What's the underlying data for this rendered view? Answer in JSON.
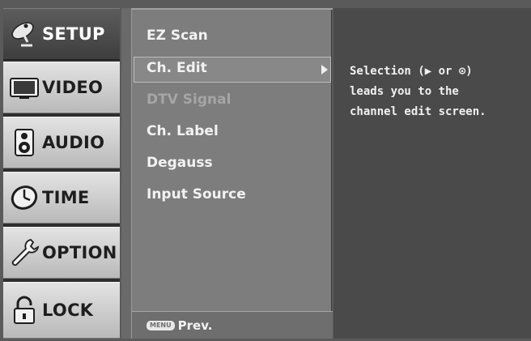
{
  "categories": [
    {
      "label": "SETUP",
      "icon": "satellite-dish-icon",
      "selected": true
    },
    {
      "label": "VIDEO",
      "icon": "monitor-icon",
      "selected": false
    },
    {
      "label": "AUDIO",
      "icon": "speaker-icon",
      "selected": false
    },
    {
      "label": "TIME",
      "icon": "clock-icon",
      "selected": false
    },
    {
      "label": "OPTION",
      "icon": "wrench-icon",
      "selected": false
    },
    {
      "label": "LOCK",
      "icon": "padlock-icon",
      "selected": false
    }
  ],
  "menu": {
    "items": [
      {
        "label": "EZ Scan",
        "enabled": true
      },
      {
        "label": "Ch. Edit",
        "enabled": true,
        "highlighted": true
      },
      {
        "label": "DTV Signal",
        "enabled": false
      },
      {
        "label": "Ch. Label",
        "enabled": true
      },
      {
        "label": "Degauss",
        "enabled": true
      },
      {
        "label": "Input Source",
        "enabled": true
      }
    ],
    "footer_key": "MENU",
    "footer_label": "Prev."
  },
  "help": {
    "text": "Selection (▶ or ⊙)\nleads you to the\nchannel edit screen."
  },
  "colors": {
    "selected_tab": "#4a4a4a",
    "unselected_tab": "#d0d0d0",
    "menu_panel": "#7d7d7d",
    "help_panel": "#4a4a4a",
    "text": "#f2f2f2",
    "disabled_text": "#a6a6a6"
  }
}
